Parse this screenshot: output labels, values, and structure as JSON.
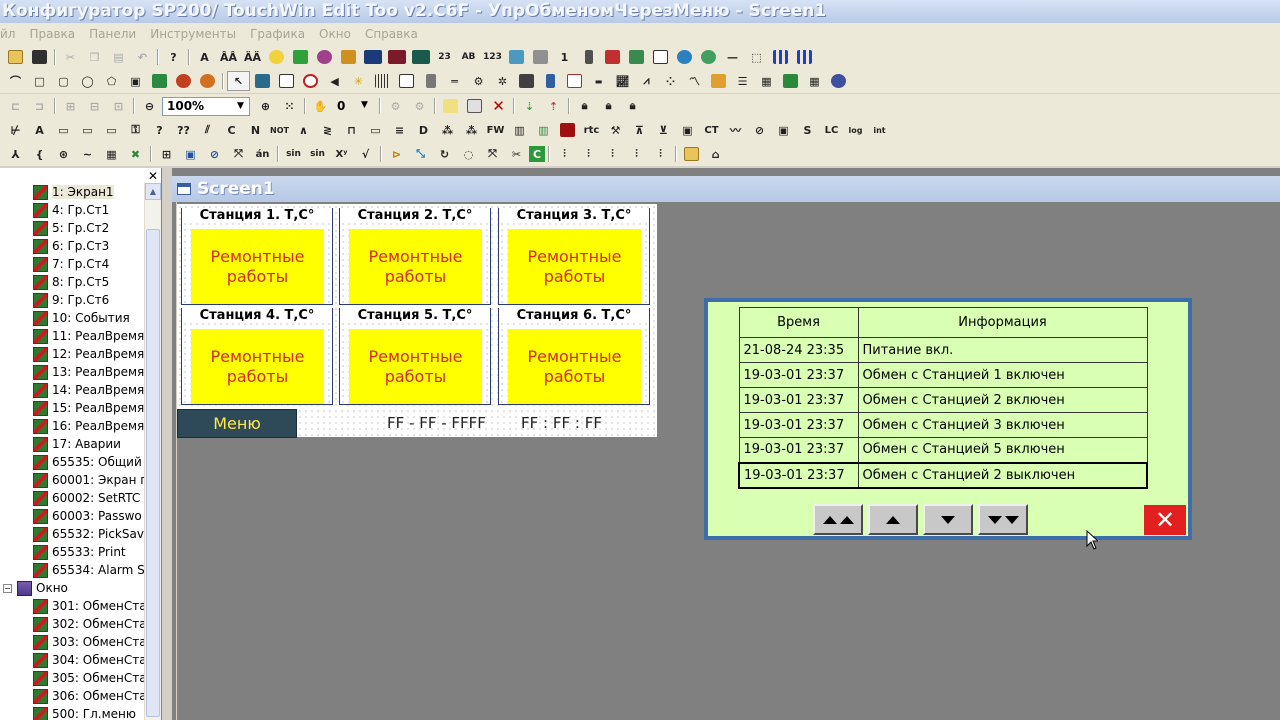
{
  "window": {
    "title": "Конфигуратор SP200/ TouchWin Edit Too v2.C6F - УпрОбменомЧерезМеню - Screen1"
  },
  "menubar": [
    "йл",
    "Правка",
    "Панели",
    "Инструменты",
    "Графика",
    "Окно",
    "Справка"
  ],
  "toolbar": {
    "zoom": "100%",
    "layer": "0"
  },
  "tree": {
    "items": [
      {
        "label": "1: Экран1"
      },
      {
        "label": "4: Гр.Ст1"
      },
      {
        "label": "5: Гр.Ст2"
      },
      {
        "label": "6: Гр.Ст3"
      },
      {
        "label": "7: Гр.Ст4"
      },
      {
        "label": "8: Гр.Ст5"
      },
      {
        "label": "9: Гр.Ст6"
      },
      {
        "label": "10: События"
      },
      {
        "label": "11: РеалВремя"
      },
      {
        "label": "12: РеалВремя"
      },
      {
        "label": "13: РеалВремя"
      },
      {
        "label": "14: РеалВремя"
      },
      {
        "label": "15: РеалВремя"
      },
      {
        "label": "16: РеалВремя"
      },
      {
        "label": "17: Аварии"
      },
      {
        "label": "65535: Общий"
      },
      {
        "label": "60001: Экран г"
      },
      {
        "label": "60002: SetRTC"
      },
      {
        "label": "60003: Passwo"
      },
      {
        "label": "65532: PickSav"
      },
      {
        "label": "65533: Print"
      },
      {
        "label": "65534: Alarm S"
      }
    ],
    "folder": "Окно",
    "window_items": [
      {
        "label": "301: ОбменСта"
      },
      {
        "label": "302: ОбменСта"
      },
      {
        "label": "303: ОбменСта"
      },
      {
        "label": "304: ОбменСта"
      },
      {
        "label": "305: ОбменСта"
      },
      {
        "label": "306: ОбменСта"
      },
      {
        "label": "500: Гл.меню"
      }
    ]
  },
  "child_window": {
    "title": "Screen1"
  },
  "stations": [
    {
      "title": "Станция 1. Т,С°",
      "line1": "Ремонтные",
      "line2": "работы"
    },
    {
      "title": "Станция 2. Т,С°",
      "line1": "Ремонтные",
      "line2": "работы"
    },
    {
      "title": "Станция 3. Т,С°",
      "line1": "Ремонтные",
      "line2": "работы"
    },
    {
      "title": "Станция 4. Т,С°",
      "line1": "Ремонтные",
      "line2": "работы"
    },
    {
      "title": "Станция 5. Т,С°",
      "line1": "Ремонтные",
      "line2": "работы"
    },
    {
      "title": "Станция 6. Т,С°",
      "line1": "Ремонтные",
      "line2": "работы"
    }
  ],
  "menu_button": "Меню",
  "date_field": "FF - FF - FFFF",
  "time_field": "FF : FF : FF",
  "info": {
    "headers": {
      "time": "Время",
      "info": "Информация"
    },
    "rows": [
      {
        "time": "21-08-24 23:35",
        "info": "Питание вкл."
      },
      {
        "time": "19-03-01 23:37",
        "info": "Обмен с Станцией 1 включен"
      },
      {
        "time": "19-03-01 23:37",
        "info": "Обмен с Станцией 2 включен"
      },
      {
        "time": "19-03-01 23:37",
        "info": "Обмен с Станцией 3 включен"
      },
      {
        "time": "19-03-01 23:37",
        "info": "Обмен с Станцией 5 включен"
      },
      {
        "time": "19-03-01 23:37",
        "info": "Обмен с Станцией 2  выключен"
      }
    ],
    "close_glyph": "✕"
  },
  "colors": {
    "accent": "#ffff00",
    "panel": "#d9ffb3",
    "close": "#e41f1f",
    "menu_btn": "#2e4a58"
  }
}
